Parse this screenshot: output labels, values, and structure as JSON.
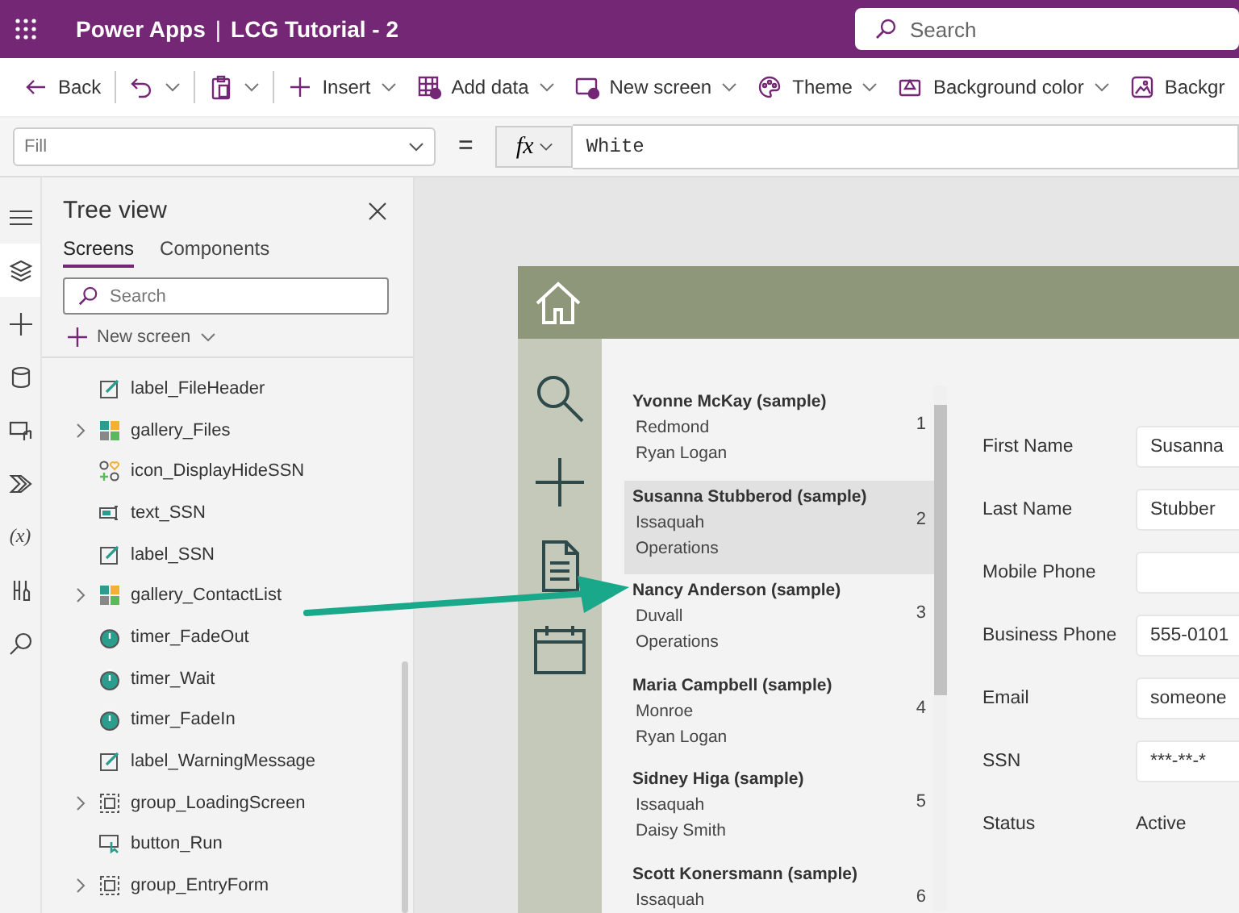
{
  "header": {
    "app": "Power Apps",
    "separator": "|",
    "title": "LCG Tutorial - 2",
    "search": {
      "placeholder": "Search"
    }
  },
  "toolbar": [
    {
      "kind": "back",
      "label": "Back",
      "dropdown": false
    },
    {
      "kind": "undo",
      "dropdown": true
    },
    {
      "kind": "paste",
      "dropdown": true
    },
    {
      "kind": "plus",
      "label": "Insert",
      "dropdown": true
    },
    {
      "kind": "table",
      "label": "Add data",
      "dropdown": true
    },
    {
      "kind": "screen",
      "label": "New screen",
      "dropdown": true
    },
    {
      "kind": "palette",
      "label": "Theme",
      "dropdown": true
    },
    {
      "kind": "paint",
      "label": "Background color",
      "dropdown": true
    },
    {
      "kind": "image",
      "label": "Backgr",
      "dropdown": false
    }
  ],
  "formula_bar": {
    "property": "Fill",
    "equals": "=",
    "fx": "fx",
    "value": "White"
  },
  "rail": [
    {
      "kind": "menu",
      "selected": false
    },
    {
      "kind": "tree",
      "selected": true
    },
    {
      "kind": "plus",
      "selected": false
    },
    {
      "kind": "data",
      "selected": false
    },
    {
      "kind": "media",
      "selected": false
    },
    {
      "kind": "automate",
      "selected": false
    },
    {
      "kind": "variables",
      "glyph": "(x)",
      "selected": false
    },
    {
      "kind": "tools",
      "selected": false
    },
    {
      "kind": "search",
      "selected": false
    }
  ],
  "tree_view": {
    "title": "Tree view",
    "tabs": [
      {
        "label": "Screens",
        "selected": true
      },
      {
        "label": "Components",
        "selected": false
      }
    ],
    "search": {
      "placeholder": "Search"
    },
    "new_screen": "New screen",
    "items": [
      {
        "kind": "label",
        "name": "label_FileHeader",
        "expandable": false
      },
      {
        "kind": "gallery",
        "name": "gallery_Files",
        "expandable": true
      },
      {
        "kind": "icon",
        "name": "icon_DisplayHideSSN",
        "expandable": false
      },
      {
        "kind": "text",
        "name": "text_SSN",
        "expandable": false
      },
      {
        "kind": "label",
        "name": "label_SSN",
        "expandable": false
      },
      {
        "kind": "gallery",
        "name": "gallery_ContactList",
        "expandable": true
      },
      {
        "kind": "timer",
        "name": "timer_FadeOut",
        "expandable": false
      },
      {
        "kind": "timer",
        "name": "timer_Wait",
        "expandable": false
      },
      {
        "kind": "timer",
        "name": "timer_FadeIn",
        "expandable": false
      },
      {
        "kind": "label",
        "name": "label_WarningMessage",
        "expandable": false
      },
      {
        "kind": "group",
        "name": "group_LoadingScreen",
        "expandable": true
      },
      {
        "kind": "button",
        "name": "button_Run",
        "expandable": false
      },
      {
        "kind": "group",
        "name": "group_EntryForm",
        "expandable": true
      }
    ]
  },
  "app_nav": [
    {
      "kind": "search"
    },
    {
      "kind": "plus"
    },
    {
      "kind": "document"
    },
    {
      "kind": "calendar"
    }
  ],
  "gallery": [
    {
      "name": "Yvonne McKay (sample)",
      "line_2": "Redmond",
      "line_3": "Ryan Logan",
      "number": "1",
      "selected": false
    },
    {
      "name": "Susanna Stubberod (sample)",
      "line_2": "Issaquah",
      "line_3": "Operations",
      "number": "2",
      "selected": true
    },
    {
      "name": "Nancy Anderson (sample)",
      "line_2": "Duvall",
      "line_3": "Operations",
      "number": "3",
      "selected": false
    },
    {
      "name": "Maria Campbell (sample)",
      "line_2": "Monroe",
      "line_3": "Ryan Logan",
      "number": "4",
      "selected": false
    },
    {
      "name": "Sidney Higa (sample)",
      "line_2": "Issaquah",
      "line_3": "Daisy Smith",
      "number": "5",
      "selected": false
    },
    {
      "name": "Scott Konersmann (sample)",
      "line_2": "Issaquah",
      "number": "6",
      "selected": false
    }
  ],
  "form": [
    {
      "label": "First Name",
      "kind": "field",
      "value": "Susanna"
    },
    {
      "label": "Last Name",
      "kind": "field",
      "value": "Stubber"
    },
    {
      "label": "Mobile Phone",
      "kind": "field"
    },
    {
      "label": "Business Phone",
      "kind": "field",
      "value": "555-0101"
    },
    {
      "label": "Email",
      "kind": "field",
      "value": "someone"
    },
    {
      "label": "SSN",
      "kind": "field",
      "value": "***-**-*"
    },
    {
      "label": "Status",
      "kind": "text",
      "value": "Active"
    }
  ]
}
